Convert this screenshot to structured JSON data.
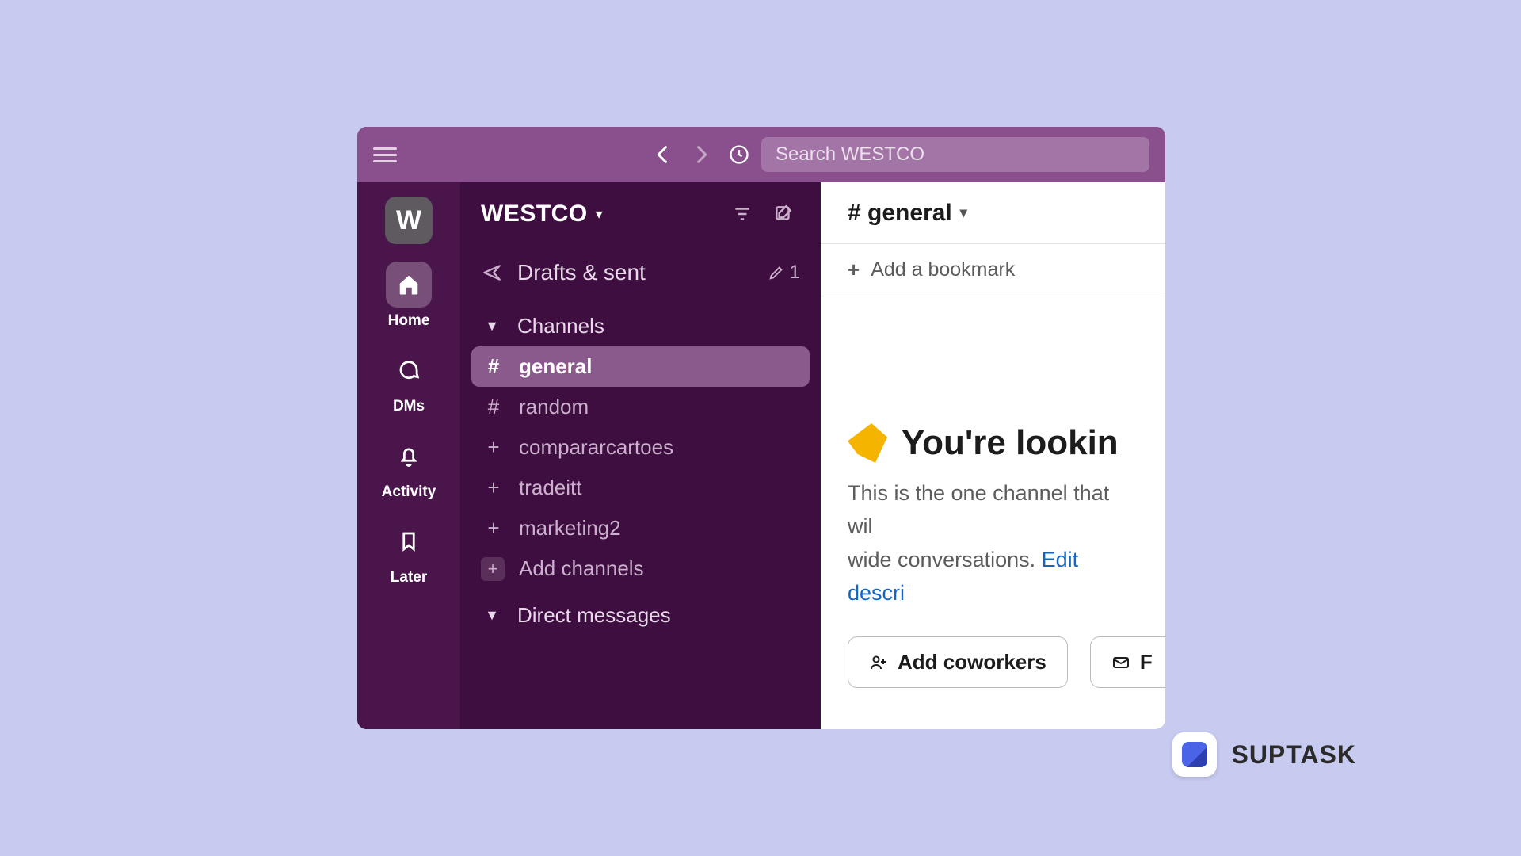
{
  "topbar": {
    "search_placeholder": "Search WESTCO"
  },
  "rail": {
    "workspace_initial": "W",
    "items": [
      {
        "label": "Home"
      },
      {
        "label": "DMs"
      },
      {
        "label": "Activity"
      },
      {
        "label": "Later"
      }
    ]
  },
  "sidebar": {
    "workspace_name": "WESTCO",
    "drafts": {
      "label": "Drafts & sent",
      "count": "1"
    },
    "sections": {
      "channels_label": "Channels",
      "dms_label": "Direct messages",
      "add_channels_label": "Add channels"
    },
    "channels": [
      {
        "prefix": "#",
        "name": "general",
        "active": true
      },
      {
        "prefix": "#",
        "name": "random"
      },
      {
        "prefix": "+",
        "name": "compararcartoes"
      },
      {
        "prefix": "+",
        "name": "tradeitt"
      },
      {
        "prefix": "+",
        "name": "marketing2"
      }
    ]
  },
  "main": {
    "channel_title": "# general",
    "bookmark_label": "Add a bookmark",
    "hero_title": "You're lookin",
    "desc_line1": "This is the one channel that wil",
    "desc_line2_prefix": "wide conversations. ",
    "desc_link": "Edit descri",
    "buttons": {
      "add_coworkers": "Add coworkers",
      "forward_partial": "F"
    }
  },
  "brand": {
    "name": "SUPTASK"
  }
}
